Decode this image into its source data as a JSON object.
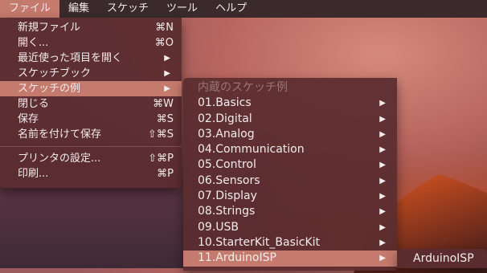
{
  "menubar": {
    "items": [
      {
        "label": "ファイル"
      },
      {
        "label": "編集"
      },
      {
        "label": "スケッチ"
      },
      {
        "label": "ツール"
      },
      {
        "label": "ヘルプ"
      }
    ]
  },
  "file_menu": {
    "items": [
      {
        "label": "新規ファイル",
        "shortcut": "⌘N"
      },
      {
        "label": "開く...",
        "shortcut": "⌘O"
      },
      {
        "label": "最近使った項目を開く",
        "arrow": "▶"
      },
      {
        "label": "スケッチブック",
        "arrow": "▶"
      },
      {
        "label": "スケッチの例",
        "arrow": "▶"
      },
      {
        "label": "閉じる",
        "shortcut": "⌘W"
      },
      {
        "label": "保存",
        "shortcut": "⌘S"
      },
      {
        "label": "名前を付けて保存",
        "shortcut": "⇧⌘S"
      },
      {
        "label": "プリンタの設定...",
        "shortcut": "⇧⌘P"
      },
      {
        "label": "印刷...",
        "shortcut": "⌘P"
      }
    ]
  },
  "examples_menu": {
    "header": "内蔵のスケッチ例",
    "items": [
      {
        "label": "01.Basics",
        "arrow": "▶"
      },
      {
        "label": "02.Digital",
        "arrow": "▶"
      },
      {
        "label": "03.Analog",
        "arrow": "▶"
      },
      {
        "label": "04.Communication",
        "arrow": "▶"
      },
      {
        "label": "05.Control",
        "arrow": "▶"
      },
      {
        "label": "06.Sensors",
        "arrow": "▶"
      },
      {
        "label": "07.Display",
        "arrow": "▶"
      },
      {
        "label": "08.Strings",
        "arrow": "▶"
      },
      {
        "label": "09.USB",
        "arrow": "▶"
      },
      {
        "label": "10.StarterKit_BasicKit",
        "arrow": "▶"
      },
      {
        "label": "11.ArduinoISP",
        "arrow": "▶"
      }
    ]
  },
  "arduinoisp_menu": {
    "items": [
      {
        "label": "ArduinoISP"
      }
    ]
  }
}
